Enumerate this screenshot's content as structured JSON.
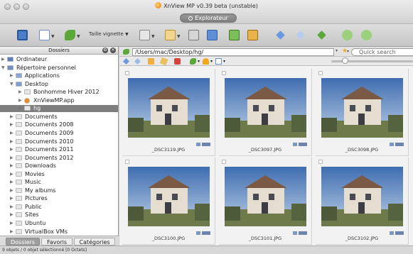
{
  "window": {
    "title": "XnView MP v0.39 beta (unstable)",
    "tab": "Explorateur"
  },
  "toolbar": {
    "thumbnail_size_label": "Taille vignette"
  },
  "sidebar": {
    "header": "Dossiers",
    "items": [
      {
        "label": "Ordinateur",
        "depth": 0,
        "expanded": false,
        "icon": "computer-icon"
      },
      {
        "label": "Répertoire personnel",
        "depth": 0,
        "expanded": true,
        "icon": "home-folder-icon"
      },
      {
        "label": "Applications",
        "depth": 1,
        "expanded": false,
        "icon": "applications-folder-icon"
      },
      {
        "label": "Desktop",
        "depth": 1,
        "expanded": true,
        "icon": "desktop-folder-icon"
      },
      {
        "label": "Bonhomme Hiver 2012",
        "depth": 2,
        "expanded": false,
        "icon": "folder-icon"
      },
      {
        "label": "XnViewMP.app",
        "depth": 2,
        "expanded": false,
        "icon": "xnview-app-icon"
      },
      {
        "label": "hg",
        "depth": 2,
        "expanded": false,
        "icon": "folder-icon",
        "selected": true
      },
      {
        "label": "Documents",
        "depth": 1,
        "expanded": false,
        "icon": "folder-icon"
      },
      {
        "label": "Documents 2008",
        "depth": 1,
        "expanded": false,
        "icon": "folder-icon"
      },
      {
        "label": "Documents 2009",
        "depth": 1,
        "expanded": false,
        "icon": "folder-icon"
      },
      {
        "label": "Documents 2010",
        "depth": 1,
        "expanded": false,
        "icon": "folder-icon"
      },
      {
        "label": "Documents 2011",
        "depth": 1,
        "expanded": false,
        "icon": "folder-icon"
      },
      {
        "label": "Documents 2012",
        "depth": 1,
        "expanded": false,
        "icon": "folder-icon"
      },
      {
        "label": "Downloads",
        "depth": 1,
        "expanded": false,
        "icon": "folder-icon"
      },
      {
        "label": "Movies",
        "depth": 1,
        "expanded": false,
        "icon": "folder-icon"
      },
      {
        "label": "Music",
        "depth": 1,
        "expanded": false,
        "icon": "folder-icon"
      },
      {
        "label": "My albums",
        "depth": 1,
        "expanded": false,
        "icon": "folder-icon"
      },
      {
        "label": "Pictures",
        "depth": 1,
        "expanded": false,
        "icon": "folder-icon"
      },
      {
        "label": "Public",
        "depth": 1,
        "expanded": false,
        "icon": "folder-icon"
      },
      {
        "label": "Sites",
        "depth": 1,
        "expanded": false,
        "icon": "folder-icon"
      },
      {
        "label": "Ubuntu",
        "depth": 1,
        "expanded": false,
        "icon": "folder-icon"
      },
      {
        "label": "VirtualBox VMs",
        "depth": 1,
        "expanded": false,
        "icon": "folder-icon"
      }
    ],
    "tabs": [
      "Dossiers",
      "Favoris",
      "Catégories"
    ]
  },
  "pathbar": {
    "path": "/Users/mac/Desktop/hg/",
    "search_placeholder": "Quick search"
  },
  "thumbnails": [
    {
      "name": "_DSC3119.JPG"
    },
    {
      "name": "_DSC3097.JPG"
    },
    {
      "name": "_DSC3098.JPG"
    },
    {
      "name": "_DSC3100.JPG"
    },
    {
      "name": "_DSC3101.JPG"
    },
    {
      "name": "_DSC3102.JPG"
    }
  ],
  "status": {
    "text": "9 objets / 0 objet sélectionné [0 Octets]"
  },
  "colors": {
    "selection": "#7e7e7e",
    "sky": "#8fa7c2",
    "house_wall": "#e4ddd0"
  }
}
